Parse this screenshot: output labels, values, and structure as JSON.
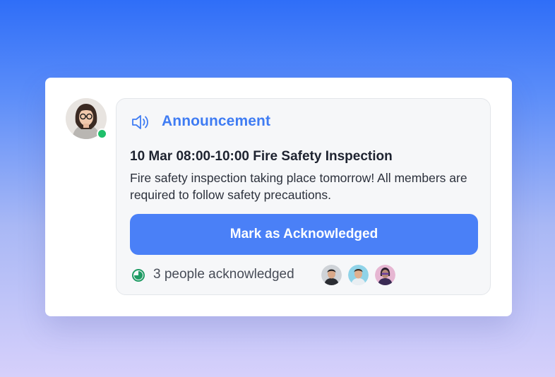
{
  "announcement": {
    "heading": "Announcement",
    "event_title": "10 Mar 08:00-10:00 Fire Safety Inspection",
    "description": "Fire safety inspection taking place tomorrow! All members are required to follow safety precautions.",
    "button_label": "Mark as Acknowledged",
    "acknowledged_text": "3 people acknowledged",
    "acknowledged_fraction": 0.75
  },
  "icons": {
    "announcement": "speaker-icon",
    "progress": "pie-progress-icon"
  },
  "colors": {
    "accent": "#3f7cf3",
    "button": "#4a80f7",
    "online": "#1fbf6a",
    "progress": "#1e9b63"
  }
}
